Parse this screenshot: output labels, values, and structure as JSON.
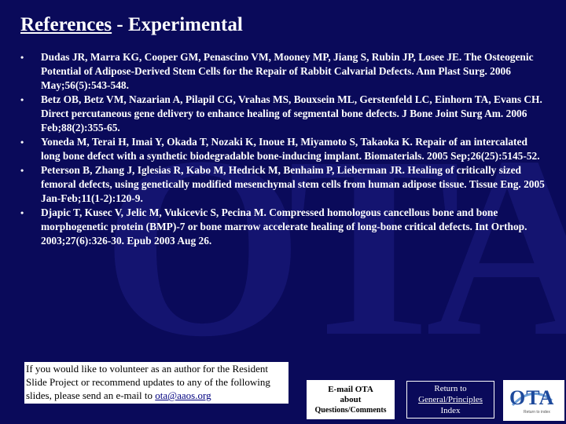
{
  "title": {
    "main": "References",
    "rest": " - Experimental"
  },
  "bullet_char": "•",
  "references": [
    "Dudas JR, Marra KG, Cooper GM, Penascino VM, Mooney MP, Jiang S, Rubin JP, Losee JE. The Osteogenic Potential of Adipose-Derived Stem Cells for the Repair of Rabbit Calvarial Defects. Ann Plast Surg. 2006 May;56(5):543-548.",
    "Betz OB, Betz VM, Nazarian A, Pilapil CG, Vrahas MS, Bouxsein ML, Gerstenfeld LC, Einhorn TA, Evans CH. Direct percutaneous gene delivery to enhance healing of segmental bone defects. J Bone Joint Surg Am. 2006 Feb;88(2):355-65.",
    "Yoneda M, Terai H, Imai Y, Okada T, Nozaki K, Inoue H, Miyamoto S, Takaoka K. Repair of an intercalated long bone defect with a synthetic biodegradable bone-inducing implant. Biomaterials. 2005 Sep;26(25):5145-52.",
    "Peterson B, Zhang J, Iglesias R, Kabo M, Hedrick M, Benhaim P, Lieberman JR. Healing of critically sized femoral defects, using genetically modified mesenchymal stem cells from human adipose tissue. Tissue Eng. 2005 Jan-Feb;11(1-2):120-9.",
    "Djapic T, Kusec V, Jelic M, Vukicevic S, Pecina M. Compressed homologous cancellous bone and bone morphogenetic protein (BMP)-7 or bone marrow accelerate healing of long-bone critical defects. Int Orthop. 2003;27(6):326-30. Epub 2003 Aug 26."
  ],
  "volunteer": {
    "text": "If you would like to volunteer as an author for the Resident Slide Project or recommend updates to any of the following slides, please send an e-mail to ",
    "email": "ota@aaos.org"
  },
  "email_button": {
    "line1": "E-mail OTA",
    "line2": "about",
    "line3": "Questions/Comments"
  },
  "return_button": {
    "line1": "Return to",
    "line2": "General/Principles",
    "line3": "Index"
  },
  "logo": {
    "text": "OTA",
    "sub": "Return to index"
  },
  "watermark": "OTA",
  "colors": {
    "background": "#0a0a5a",
    "text": "#ffffff",
    "link": "#000080"
  }
}
